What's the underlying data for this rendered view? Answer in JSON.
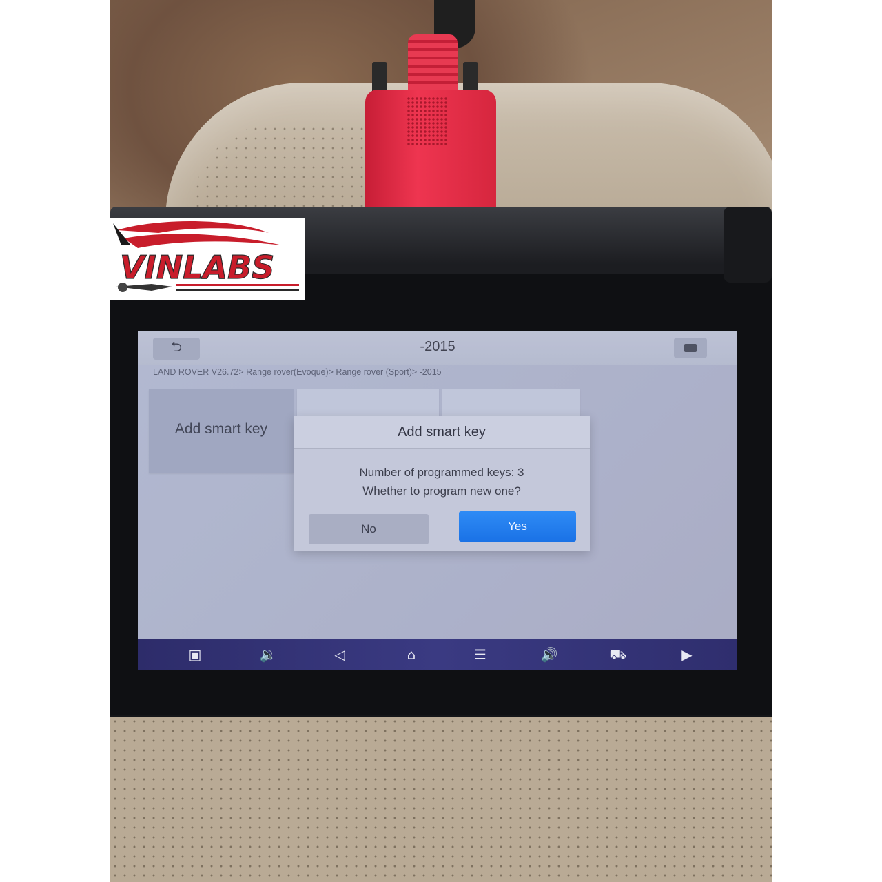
{
  "logo": {
    "text": "VINLABS"
  },
  "screen": {
    "title": "-2015",
    "breadcrumb": "LAND ROVER V26.72> Range rover(Evoque)> Range rover (Sport)> -2015",
    "tiles": [
      {
        "label": "Add smart key"
      }
    ]
  },
  "dialog": {
    "title": "Add smart key",
    "message_line1": "Number of programmed keys: 3",
    "message_line2": "Whether to program new one?",
    "no_label": "No",
    "yes_label": "Yes"
  },
  "navbar": {
    "items": [
      "gallery-icon",
      "volume-down-icon",
      "back-icon",
      "home-icon",
      "menu-icon",
      "volume-up-icon",
      "car-diagnostic-icon",
      "screen-record-icon"
    ]
  },
  "colors": {
    "yes_button": "#1a72e6",
    "connector": "#e02a44",
    "logo_red": "#d0202e"
  }
}
